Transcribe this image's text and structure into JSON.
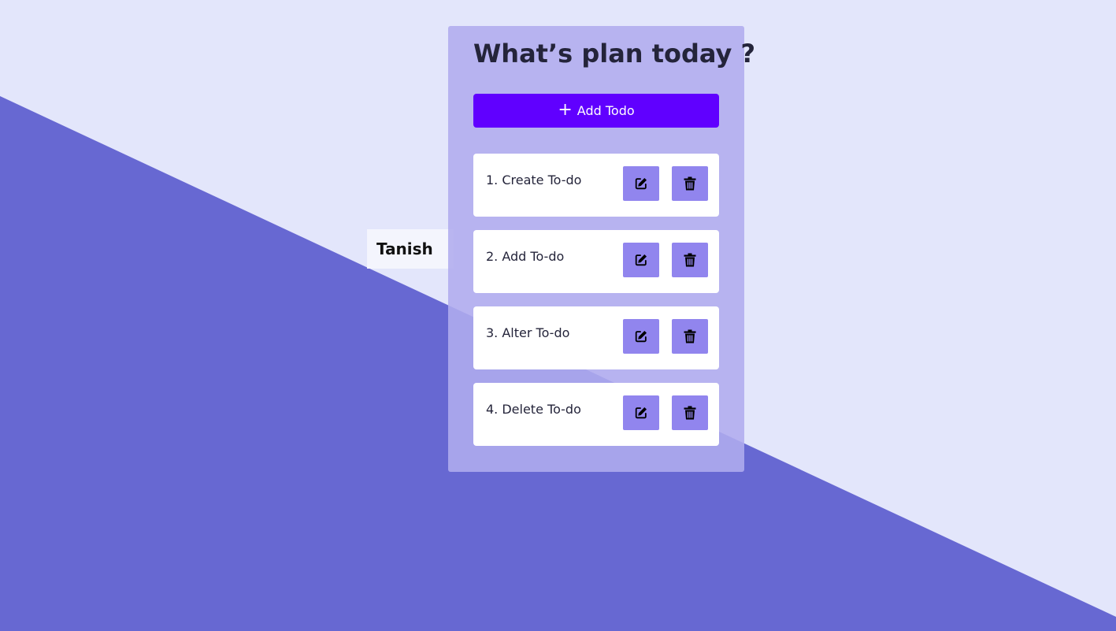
{
  "name_tag": "Tanish",
  "header": {
    "title": "What’s plan today ?"
  },
  "add_button": {
    "icon": "plus-icon",
    "label": "Add Todo"
  },
  "todos": [
    {
      "text": "1. Create To-do"
    },
    {
      "text": "2. Add To-do"
    },
    {
      "text": "3. Alter To-do"
    },
    {
      "text": "4. Delete To-do"
    }
  ],
  "item_actions": {
    "edit_icon": "edit-icon",
    "delete_icon": "trash-icon"
  },
  "colors": {
    "background_light": "#e3e6fb",
    "background_dark": "#6768d2",
    "panel": "#b0acee",
    "accent": "#6000ff",
    "action_button": "#9185ee",
    "text_dark": "#24243a"
  }
}
